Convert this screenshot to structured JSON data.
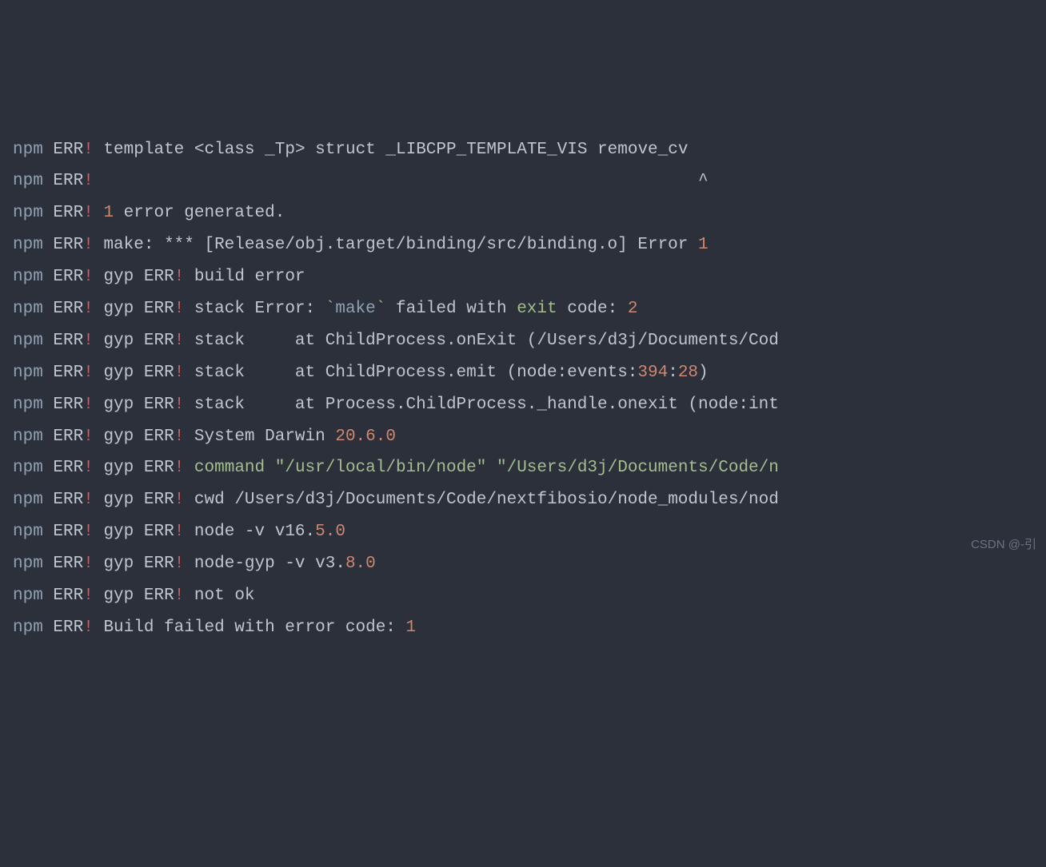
{
  "prefix": {
    "npm": "npm",
    "err": "ERR",
    "bang": "!",
    "gyp": "gyp"
  },
  "lines": {
    "l1": {
      "template": "template",
      "angle_open": "<",
      "class": "class",
      "tp": "_Tp",
      "angle_close": ">",
      "struct": "struct",
      "libcpp": "_LIBCPP_TEMPLATE_VIS",
      "remove_cv": "remove_cv"
    },
    "l2": {
      "caret": "^"
    },
    "l3": {
      "num": "1",
      "text": " error generated."
    },
    "l4": {
      "make": "make: *** [Release/obj.target/binding/src/binding.o] Error ",
      "errnum": "1"
    },
    "l5": {
      "text": "build error"
    },
    "l6": {
      "stack": "stack Error: ",
      "tick1": "`",
      "make": "make",
      "tick2": "`",
      "failed": " failed with ",
      "exit": "exit",
      "code": " code: ",
      "num": "2"
    },
    "l7": {
      "text": "stack     at ChildProcess.onExit (/Users/d3j/Documents/Cod"
    },
    "l8": {
      "pre": "stack     at ChildProcess.emit (node:events:",
      "n1": "394",
      "colon": ":",
      "n2": "28",
      "post": ")"
    },
    "l9": {
      "text": "stack     at Process.ChildProcess._handle.onexit (node:int"
    },
    "l10": {
      "sys": "System Darwin ",
      "ver": "20.6.0"
    },
    "l11": {
      "cmd": "command ",
      "path1": "\"/usr/local/bin/node\"",
      "sp": " ",
      "path2": "\"/Users/d3j/Documents/Code/n"
    },
    "l12": {
      "text": "cwd /Users/d3j/Documents/Code/nextfibosio/node_modules/nod"
    },
    "l13": {
      "text": "node -v v16.",
      "n1": "5.0"
    },
    "l14": {
      "text": "node-gyp -v v3.",
      "n1": "8.0"
    },
    "l15": {
      "text": "not ok"
    },
    "l16": {
      "text": "Build failed with error code: ",
      "num": "1"
    }
  },
  "watermark": "CSDN @-引"
}
